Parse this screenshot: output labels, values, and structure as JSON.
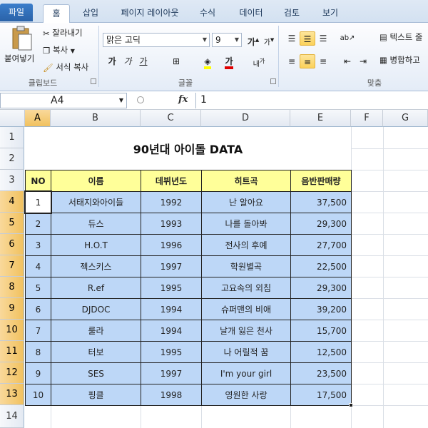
{
  "tabs": {
    "file": "파일",
    "home": "홈",
    "insert": "삽입",
    "layout": "페이지 레이아웃",
    "formula": "수식",
    "data": "데이터",
    "review": "검토",
    "view": "보기"
  },
  "clipboard": {
    "paste": "붙여넣기",
    "cut": "잘라내기",
    "copy": "복사",
    "format_painter": "서식 복사",
    "group": "클립보드"
  },
  "font": {
    "name": "맑은 고딕",
    "size": "9",
    "grow": "가",
    "shrink": "가",
    "bold": "가",
    "italic": "가",
    "underline": "가",
    "group": "글꼴"
  },
  "align": {
    "wrap": "텍스트 줄",
    "merge": "병합하고",
    "group": "맞춤"
  },
  "formula_bar": {
    "name_box": "A4",
    "fx": "fx",
    "content": "1"
  },
  "columns": [
    "A",
    "B",
    "C",
    "D",
    "E",
    "F",
    "G"
  ],
  "rows": [
    "1",
    "2",
    "3",
    "4",
    "5",
    "6",
    "7",
    "8",
    "9",
    "10",
    "11",
    "12",
    "13",
    "14"
  ],
  "sheet": {
    "title": "90년대 아이돌 DATA",
    "headers": [
      "NO",
      "이름",
      "데뷔년도",
      "히트곡",
      "음반판매량"
    ],
    "data": [
      [
        "1",
        "서태지와아이들",
        "1992",
        "난 알아요",
        "37,500"
      ],
      [
        "2",
        "듀스",
        "1993",
        "나를 돌아봐",
        "29,300"
      ],
      [
        "3",
        "H.O.T",
        "1996",
        "전사의 후예",
        "27,700"
      ],
      [
        "4",
        "젝스키스",
        "1997",
        "학원별곡",
        "22,500"
      ],
      [
        "5",
        "R.ef",
        "1995",
        "고요속의 외침",
        "29,300"
      ],
      [
        "6",
        "DJDOC",
        "1994",
        "슈퍼맨의 비애",
        "39,200"
      ],
      [
        "7",
        "룰라",
        "1994",
        "날개 잃은 천사",
        "15,700"
      ],
      [
        "8",
        "터보",
        "1995",
        "나 어릴적 꿈",
        "12,500"
      ],
      [
        "9",
        "SES",
        "1997",
        "I'm your girl",
        "23,500"
      ],
      [
        "10",
        "핑클",
        "1998",
        "영원한 사랑",
        "17,500"
      ]
    ]
  }
}
